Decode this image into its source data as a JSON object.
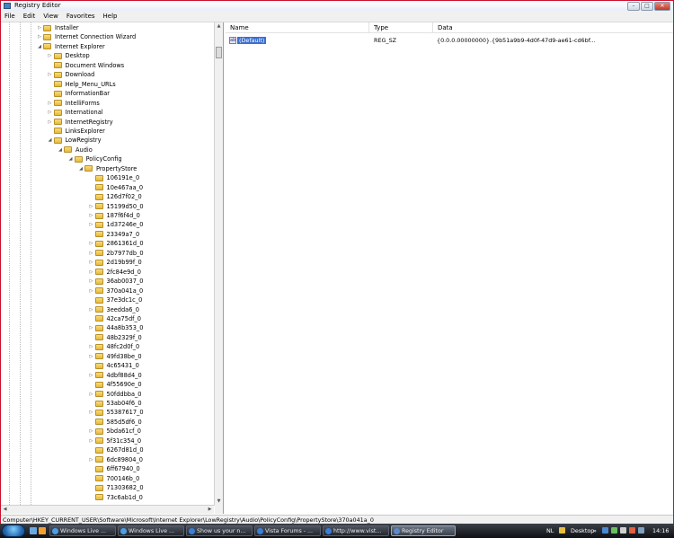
{
  "window": {
    "title": "Registry Editor",
    "controls": {
      "minimize": "–",
      "maximize": "□",
      "close": "✕"
    }
  },
  "menu": [
    "File",
    "Edit",
    "View",
    "Favorites",
    "Help"
  ],
  "tree": {
    "nodes": [
      {
        "label": "Installer",
        "level": 0,
        "arrow": "▷"
      },
      {
        "label": "Internet Connection Wizard",
        "level": 0,
        "arrow": "▷"
      },
      {
        "label": "Internet Explorer",
        "level": 0,
        "arrow": "◢"
      },
      {
        "label": "Desktop",
        "level": 1,
        "arrow": "▷"
      },
      {
        "label": "Document Windows",
        "level": 1,
        "arrow": ""
      },
      {
        "label": "Download",
        "level": 1,
        "arrow": "▷"
      },
      {
        "label": "Help_Menu_URLs",
        "level": 1,
        "arrow": ""
      },
      {
        "label": "InformationBar",
        "level": 1,
        "arrow": ""
      },
      {
        "label": "IntelliForms",
        "level": 1,
        "arrow": "▷"
      },
      {
        "label": "International",
        "level": 1,
        "arrow": "▷"
      },
      {
        "label": "InternetRegistry",
        "level": 1,
        "arrow": "▷"
      },
      {
        "label": "LinksExplorer",
        "level": 1,
        "arrow": ""
      },
      {
        "label": "LowRegistry",
        "level": 1,
        "arrow": "◢"
      },
      {
        "label": "Audio",
        "level": 2,
        "arrow": "◢"
      },
      {
        "label": "PolicyConfig",
        "level": 3,
        "arrow": "◢"
      },
      {
        "label": "PropertyStore",
        "level": 4,
        "arrow": "◢"
      },
      {
        "label": "106191e_0",
        "level": 5,
        "arrow": ""
      },
      {
        "label": "10e467aa_0",
        "level": 5,
        "arrow": ""
      },
      {
        "label": "126d7f02_0",
        "level": 5,
        "arrow": ""
      },
      {
        "label": "15199d50_0",
        "level": 5,
        "arrow": "▷"
      },
      {
        "label": "187f6f4d_0",
        "level": 5,
        "arrow": "▷"
      },
      {
        "label": "1d37246e_0",
        "level": 5,
        "arrow": "▷"
      },
      {
        "label": "23349a7_0",
        "level": 5,
        "arrow": ""
      },
      {
        "label": "2861361d_0",
        "level": 5,
        "arrow": "▷"
      },
      {
        "label": "2b7977db_0",
        "level": 5,
        "arrow": "▷"
      },
      {
        "label": "2d19b99f_0",
        "level": 5,
        "arrow": "▷"
      },
      {
        "label": "2fc84e9d_0",
        "level": 5,
        "arrow": "▷"
      },
      {
        "label": "36ab0037_0",
        "level": 5,
        "arrow": "▷"
      },
      {
        "label": "370a041a_0",
        "level": 5,
        "arrow": "▷"
      },
      {
        "label": "37e3dc1c_0",
        "level": 5,
        "arrow": ""
      },
      {
        "label": "3eedda6_0",
        "level": 5,
        "arrow": "▷"
      },
      {
        "label": "42ca75df_0",
        "level": 5,
        "arrow": ""
      },
      {
        "label": "44a8b353_0",
        "level": 5,
        "arrow": "▷"
      },
      {
        "label": "48b2329f_0",
        "level": 5,
        "arrow": ""
      },
      {
        "label": "48fc2d0f_0",
        "level": 5,
        "arrow": "▷"
      },
      {
        "label": "49fd38be_0",
        "level": 5,
        "arrow": "▷"
      },
      {
        "label": "4c65431_0",
        "level": 5,
        "arrow": ""
      },
      {
        "label": "4dbf88d4_0",
        "level": 5,
        "arrow": "▷"
      },
      {
        "label": "4f55690e_0",
        "level": 5,
        "arrow": ""
      },
      {
        "label": "50fddbba_0",
        "level": 5,
        "arrow": "▷"
      },
      {
        "label": "53ab04f6_0",
        "level": 5,
        "arrow": ""
      },
      {
        "label": "55387617_0",
        "level": 5,
        "arrow": "▷"
      },
      {
        "label": "585d5df6_0",
        "level": 5,
        "arrow": ""
      },
      {
        "label": "5bda61cf_0",
        "level": 5,
        "arrow": "▷"
      },
      {
        "label": "5f31c354_0",
        "level": 5,
        "arrow": "▷"
      },
      {
        "label": "6267d81d_0",
        "level": 5,
        "arrow": ""
      },
      {
        "label": "6dc89804_0",
        "level": 5,
        "arrow": "▷"
      },
      {
        "label": "6ff67940_0",
        "level": 5,
        "arrow": ""
      },
      {
        "label": "700146b_0",
        "level": 5,
        "arrow": ""
      },
      {
        "label": "71303682_0",
        "level": 5,
        "arrow": ""
      },
      {
        "label": "73c6ab1d_0",
        "level": 5,
        "arrow": ""
      }
    ]
  },
  "values_pane": {
    "columns": {
      "name": "Name",
      "type": "Type",
      "data": "Data"
    },
    "rows": [
      {
        "icon": "ab",
        "name": "(Default)",
        "type": "REG_SZ",
        "data": "{0.0.0.00000000}.{9b51a9b9-4d0f-47d9-ae61-cd6bf..."
      }
    ]
  },
  "status": {
    "path": "Computer\\HKEY_CURRENT_USER\\Software\\Microsoft\\Internet Explorer\\LowRegistry\\Audio\\PolicyConfig\\PropertyStore\\370a041a_0"
  },
  "taskbar": {
    "buttons": [
      {
        "label": "Windows Live ...",
        "active": false,
        "icon_color": "#4aa0e8"
      },
      {
        "label": "Windows Live ...",
        "active": false,
        "icon_color": "#4aa0e8"
      },
      {
        "label": "Show us your n...",
        "active": false,
        "icon_color": "#3a7fd8"
      },
      {
        "label": "Vista Forums - ...",
        "active": false,
        "icon_color": "#3a7fd8"
      },
      {
        "label": "http://www.vist...",
        "active": false,
        "icon_color": "#3a7fd8"
      },
      {
        "label": "Registry Editor",
        "active": true,
        "icon_color": "#5a8ac8"
      }
    ],
    "language": "NL",
    "desktop": "Desktop",
    "chevron": "»",
    "time": "14:16"
  }
}
